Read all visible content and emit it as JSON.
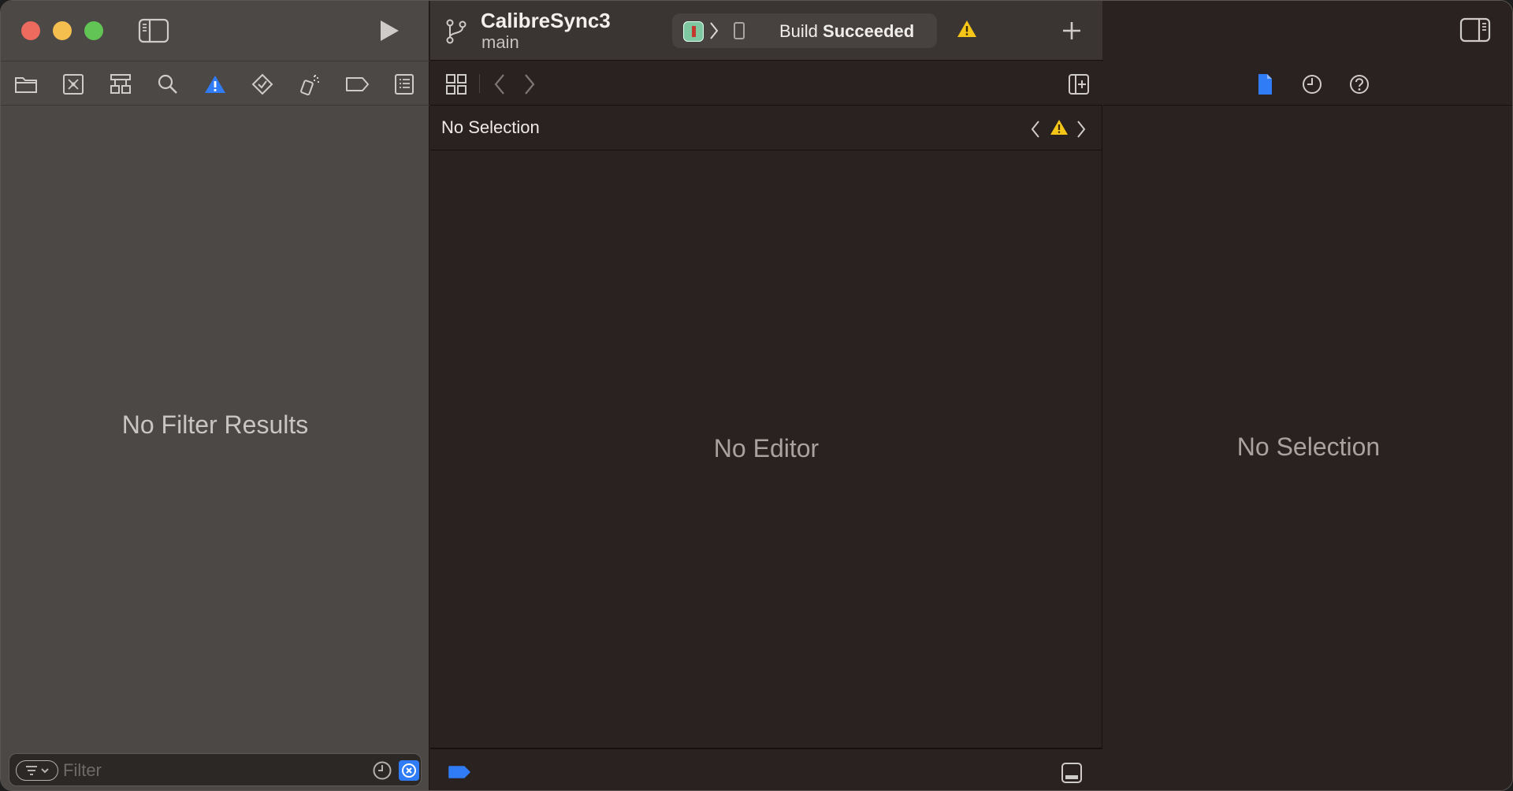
{
  "toolbar": {
    "project_name": "CalibreSync3",
    "branch": "main",
    "build_status_prefix": "Build",
    "build_status_result": "Succeeded"
  },
  "navigator": {
    "tabs": [
      "folder-icon",
      "source-control-icon",
      "hierarchy-icon",
      "search-icon",
      "warning-icon",
      "test-diamond-icon",
      "debug-spray-icon",
      "breakpoint-tag-icon",
      "report-list-icon"
    ],
    "active_tab": "warning-icon",
    "empty_message": "No Filter Results",
    "filter_placeholder": "Filter"
  },
  "editor": {
    "jumpbar_label": "No Selection",
    "empty_message": "No Editor"
  },
  "inspector": {
    "tabs": [
      "file-icon",
      "history-icon",
      "help-icon"
    ],
    "active_tab": "file-icon",
    "empty_message": "No Selection"
  },
  "colors": {
    "accent": "#2f7cf6",
    "warning": "#f5c518",
    "close": "#ed6a5e",
    "minimize": "#f5bf4f",
    "zoom": "#61c454"
  }
}
